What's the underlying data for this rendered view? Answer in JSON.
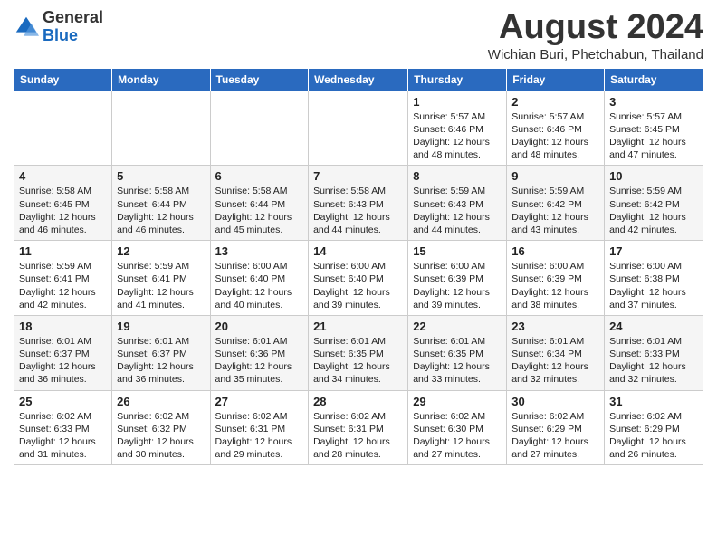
{
  "header": {
    "logo_general": "General",
    "logo_blue": "Blue",
    "month_title": "August 2024",
    "location": "Wichian Buri, Phetchabun, Thailand"
  },
  "days_of_week": [
    "Sunday",
    "Monday",
    "Tuesday",
    "Wednesday",
    "Thursday",
    "Friday",
    "Saturday"
  ],
  "weeks": [
    [
      {
        "day": "",
        "info": ""
      },
      {
        "day": "",
        "info": ""
      },
      {
        "day": "",
        "info": ""
      },
      {
        "day": "",
        "info": ""
      },
      {
        "day": "1",
        "info": "Sunrise: 5:57 AM\nSunset: 6:46 PM\nDaylight: 12 hours\nand 48 minutes."
      },
      {
        "day": "2",
        "info": "Sunrise: 5:57 AM\nSunset: 6:46 PM\nDaylight: 12 hours\nand 48 minutes."
      },
      {
        "day": "3",
        "info": "Sunrise: 5:57 AM\nSunset: 6:45 PM\nDaylight: 12 hours\nand 47 minutes."
      }
    ],
    [
      {
        "day": "4",
        "info": "Sunrise: 5:58 AM\nSunset: 6:45 PM\nDaylight: 12 hours\nand 46 minutes."
      },
      {
        "day": "5",
        "info": "Sunrise: 5:58 AM\nSunset: 6:44 PM\nDaylight: 12 hours\nand 46 minutes."
      },
      {
        "day": "6",
        "info": "Sunrise: 5:58 AM\nSunset: 6:44 PM\nDaylight: 12 hours\nand 45 minutes."
      },
      {
        "day": "7",
        "info": "Sunrise: 5:58 AM\nSunset: 6:43 PM\nDaylight: 12 hours\nand 44 minutes."
      },
      {
        "day": "8",
        "info": "Sunrise: 5:59 AM\nSunset: 6:43 PM\nDaylight: 12 hours\nand 44 minutes."
      },
      {
        "day": "9",
        "info": "Sunrise: 5:59 AM\nSunset: 6:42 PM\nDaylight: 12 hours\nand 43 minutes."
      },
      {
        "day": "10",
        "info": "Sunrise: 5:59 AM\nSunset: 6:42 PM\nDaylight: 12 hours\nand 42 minutes."
      }
    ],
    [
      {
        "day": "11",
        "info": "Sunrise: 5:59 AM\nSunset: 6:41 PM\nDaylight: 12 hours\nand 42 minutes."
      },
      {
        "day": "12",
        "info": "Sunrise: 5:59 AM\nSunset: 6:41 PM\nDaylight: 12 hours\nand 41 minutes."
      },
      {
        "day": "13",
        "info": "Sunrise: 6:00 AM\nSunset: 6:40 PM\nDaylight: 12 hours\nand 40 minutes."
      },
      {
        "day": "14",
        "info": "Sunrise: 6:00 AM\nSunset: 6:40 PM\nDaylight: 12 hours\nand 39 minutes."
      },
      {
        "day": "15",
        "info": "Sunrise: 6:00 AM\nSunset: 6:39 PM\nDaylight: 12 hours\nand 39 minutes."
      },
      {
        "day": "16",
        "info": "Sunrise: 6:00 AM\nSunset: 6:39 PM\nDaylight: 12 hours\nand 38 minutes."
      },
      {
        "day": "17",
        "info": "Sunrise: 6:00 AM\nSunset: 6:38 PM\nDaylight: 12 hours\nand 37 minutes."
      }
    ],
    [
      {
        "day": "18",
        "info": "Sunrise: 6:01 AM\nSunset: 6:37 PM\nDaylight: 12 hours\nand 36 minutes."
      },
      {
        "day": "19",
        "info": "Sunrise: 6:01 AM\nSunset: 6:37 PM\nDaylight: 12 hours\nand 36 minutes."
      },
      {
        "day": "20",
        "info": "Sunrise: 6:01 AM\nSunset: 6:36 PM\nDaylight: 12 hours\nand 35 minutes."
      },
      {
        "day": "21",
        "info": "Sunrise: 6:01 AM\nSunset: 6:35 PM\nDaylight: 12 hours\nand 34 minutes."
      },
      {
        "day": "22",
        "info": "Sunrise: 6:01 AM\nSunset: 6:35 PM\nDaylight: 12 hours\nand 33 minutes."
      },
      {
        "day": "23",
        "info": "Sunrise: 6:01 AM\nSunset: 6:34 PM\nDaylight: 12 hours\nand 32 minutes."
      },
      {
        "day": "24",
        "info": "Sunrise: 6:01 AM\nSunset: 6:33 PM\nDaylight: 12 hours\nand 32 minutes."
      }
    ],
    [
      {
        "day": "25",
        "info": "Sunrise: 6:02 AM\nSunset: 6:33 PM\nDaylight: 12 hours\nand 31 minutes."
      },
      {
        "day": "26",
        "info": "Sunrise: 6:02 AM\nSunset: 6:32 PM\nDaylight: 12 hours\nand 30 minutes."
      },
      {
        "day": "27",
        "info": "Sunrise: 6:02 AM\nSunset: 6:31 PM\nDaylight: 12 hours\nand 29 minutes."
      },
      {
        "day": "28",
        "info": "Sunrise: 6:02 AM\nSunset: 6:31 PM\nDaylight: 12 hours\nand 28 minutes."
      },
      {
        "day": "29",
        "info": "Sunrise: 6:02 AM\nSunset: 6:30 PM\nDaylight: 12 hours\nand 27 minutes."
      },
      {
        "day": "30",
        "info": "Sunrise: 6:02 AM\nSunset: 6:29 PM\nDaylight: 12 hours\nand 27 minutes."
      },
      {
        "day": "31",
        "info": "Sunrise: 6:02 AM\nSunset: 6:29 PM\nDaylight: 12 hours\nand 26 minutes."
      }
    ]
  ]
}
